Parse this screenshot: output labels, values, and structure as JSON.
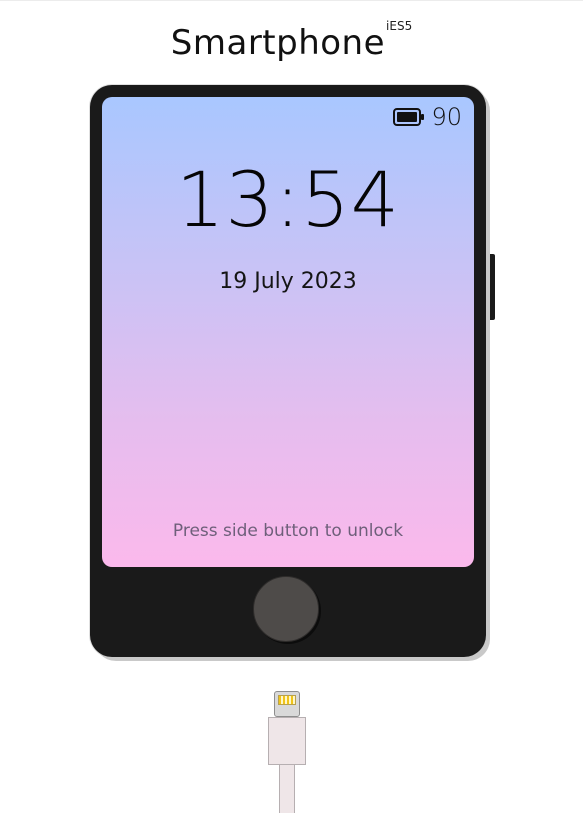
{
  "header": {
    "title": "Smartphone",
    "version": "iES5"
  },
  "phone": {
    "status_bar": {
      "battery_icon": "battery-icon",
      "battery_level": "90"
    },
    "lock_screen": {
      "time": "13:54",
      "date": "19 July 2023",
      "unlock_hint": "Press side button to unlock"
    },
    "colors": {
      "body": "#1a1a1a",
      "screen_top": "#a9c7ff",
      "screen_bottom": "#fbb9ec",
      "home_button": "#4e4b49"
    }
  }
}
